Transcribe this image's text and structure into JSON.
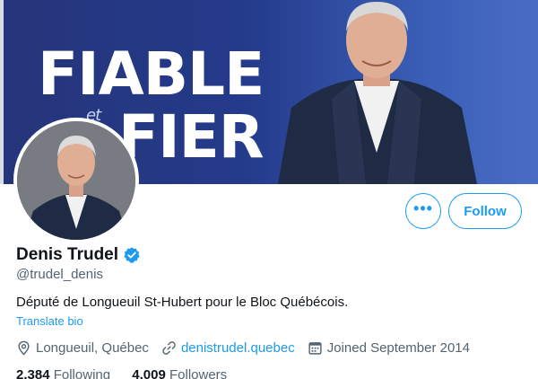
{
  "banner": {
    "headline_line1": "FIABLE",
    "headline_connector": "et",
    "headline_line2": "FIER",
    "background_colors": [
      "#26357a",
      "#4a6cc4"
    ]
  },
  "profile": {
    "display_name": "Denis Trudel",
    "verified": true,
    "handle": "@trudel_denis",
    "bio": "Député de Longueuil St-Hubert pour le Bloc Québécois.",
    "translate_label": "Translate bio",
    "location": "Longueuil, Québec",
    "website": "denistrudel.quebec",
    "joined": "Joined September 2014"
  },
  "actions": {
    "more_label": "•••",
    "follow_label": "Follow"
  },
  "stats": {
    "following_count": "2,384",
    "following_label": "Following",
    "followers_count": "4,009",
    "followers_label": "Followers"
  },
  "colors": {
    "accent": "#1d9bf0",
    "secondary_text": "#536471",
    "primary_text": "#0f1419"
  },
  "icons": {
    "location": "location-pin-icon",
    "website": "link-icon",
    "joined": "calendar-icon",
    "verified": "verified-badge-icon",
    "more": "more-dots-icon"
  }
}
